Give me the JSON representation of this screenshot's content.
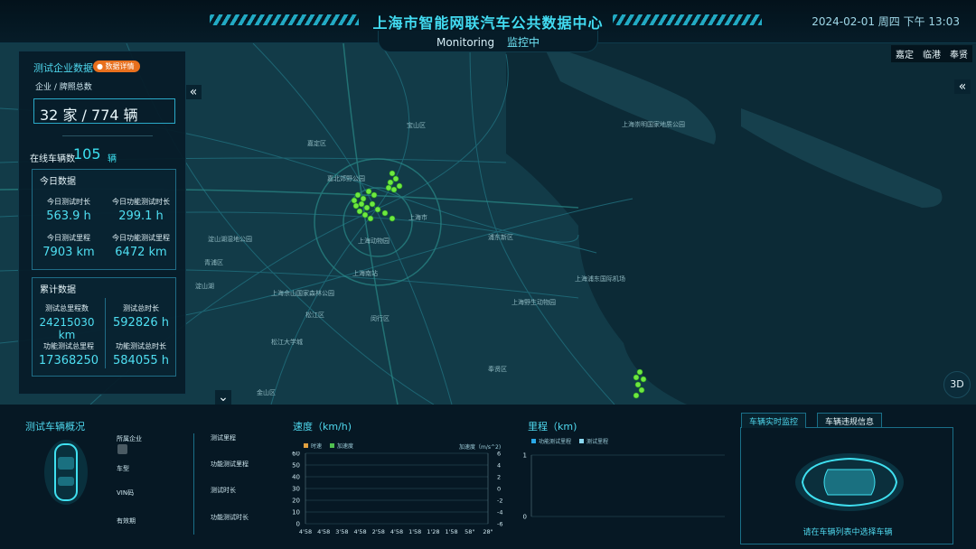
{
  "header": {
    "title": "上海市智能网联汽车公共数据中心",
    "datetime": "2024-02-01 周四 下午 13:03",
    "tabs": [
      {
        "label": "Monitoring",
        "active": false
      },
      {
        "label": "监控中",
        "active": true
      }
    ]
  },
  "districts": [
    "嘉定",
    "临港",
    "奉贤"
  ],
  "map": {
    "labels": [
      "上海崇明国家地质公园",
      "上海浦东国际机场",
      "上海野生动物园",
      "嘉北郊野公园",
      "上海动物园",
      "淀山湖",
      "青浦区",
      "松江区",
      "闵行区",
      "浦东新区",
      "宝山区",
      "嘉定区",
      "金山区",
      "奉贤区",
      "上海市",
      "上海南站",
      "松江大学城",
      "淀山湖湿地公园",
      "上海佘山国家森林公园"
    ],
    "accent_color": "#4fd8ee",
    "vehicle_dot_color": "#6ee840"
  },
  "left_panel": {
    "title": "测试企业数据",
    "detail_button": "数据详情",
    "subtitle": "企业 / 牌照总数",
    "total": "32 家 / 774 辆",
    "online_label": "在线车辆数",
    "online_count": "105",
    "online_unit": "辆",
    "today": {
      "title": "今日数据",
      "items": [
        {
          "label": "今日测试时长",
          "value": "563.9 h"
        },
        {
          "label": "今日功能测试时长",
          "value": "299.1 h"
        },
        {
          "label": "今日测试里程",
          "value": "7903 km"
        },
        {
          "label": "今日功能测试里程",
          "value": "6472 km"
        }
      ]
    },
    "cumulative": {
      "title": "累计数据",
      "items": [
        {
          "label": "测试总里程数",
          "value": "24215030 km"
        },
        {
          "label": "测试总时长",
          "value": "592826 h"
        },
        {
          "label": "功能测试总里程",
          "value": "17368250"
        },
        {
          "label": "功能测试总时长",
          "value": "584055 h"
        }
      ]
    }
  },
  "map_controls": {
    "collapse_left": "«",
    "collapse_right": "«",
    "collapse_down": "⌄",
    "btn_3d": "3D"
  },
  "bottom": {
    "vehicle_overview": {
      "title": "测试车辆概况",
      "fields": [
        "所属企业",
        "车型",
        "VIN码",
        "有效期"
      ],
      "metrics": [
        "测试里程",
        "功能测试里程",
        "测试时长",
        "功能测试时长"
      ]
    },
    "realtime": {
      "tabs": [
        "车辆实时监控",
        "车辆违规信息"
      ],
      "message": "请在车辆列表中选择车辆"
    }
  },
  "chart_data": [
    {
      "type": "line",
      "title": "速度（km/h)",
      "series": [
        {
          "name": "时速",
          "color": "#e0a040",
          "values": []
        },
        {
          "name": "加速度",
          "color": "#50c050",
          "values": []
        }
      ],
      "x": [
        "4'58",
        "4'58",
        "3'58",
        "4'58",
        "2'58",
        "4'58",
        "1'58",
        "1'28",
        "1'58",
        "58\"",
        "28\""
      ],
      "ylabel": "",
      "y2label": "加速度（m/s^2)",
      "ylim": [
        0,
        60
      ],
      "yticks": [
        0,
        10,
        20,
        30,
        40,
        50,
        60
      ],
      "y2lim": [
        -6,
        6
      ],
      "y2ticks": [
        6,
        4,
        2,
        0,
        -2,
        -4,
        -6
      ]
    },
    {
      "type": "line",
      "title": "里程（km)",
      "series": [
        {
          "name": "功能测试里程",
          "color": "#2aa9e8",
          "values": []
        },
        {
          "name": "测试里程",
          "color": "#8ad8f0",
          "values": []
        }
      ],
      "x": [],
      "ylim": [
        0,
        1
      ],
      "yticks": [
        0,
        1
      ]
    }
  ]
}
